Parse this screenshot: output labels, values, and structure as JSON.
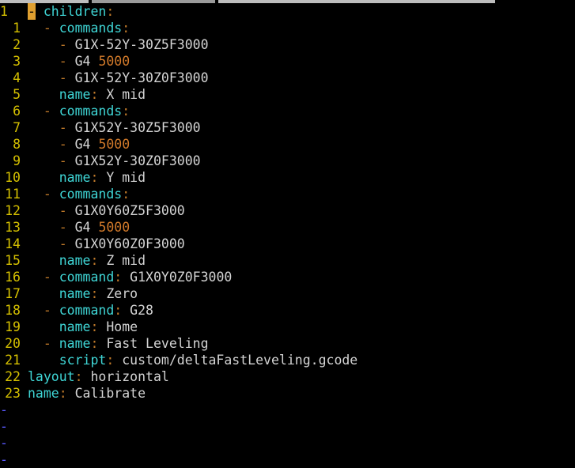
{
  "colors": {
    "background": "#000000",
    "line_number": "#d6c100",
    "key": "#3fd6d6",
    "punctuation": "#c07a2a",
    "number": "#d27a2a",
    "text": "#d4d4d4",
    "cursor": "#e0a030",
    "tilde": "#5a5aff"
  },
  "editor": {
    "lines": [
      {
        "num": "1",
        "tokens": [
          {
            "t": "cursor",
            "v": "-"
          },
          {
            "t": "plain",
            "v": " "
          },
          {
            "t": "key",
            "v": "children"
          },
          {
            "t": "punct",
            "v": ":"
          }
        ]
      },
      {
        "num": "1",
        "tokens": [
          {
            "t": "plain",
            "v": "  "
          },
          {
            "t": "punct",
            "v": "- "
          },
          {
            "t": "key",
            "v": "commands"
          },
          {
            "t": "punct",
            "v": ":"
          }
        ]
      },
      {
        "num": "2",
        "tokens": [
          {
            "t": "plain",
            "v": "    "
          },
          {
            "t": "punct",
            "v": "- "
          },
          {
            "t": "val",
            "v": "G1X-52Y-30Z5F3000"
          }
        ]
      },
      {
        "num": "3",
        "tokens": [
          {
            "t": "plain",
            "v": "    "
          },
          {
            "t": "punct",
            "v": "- "
          },
          {
            "t": "val",
            "v": "G4 "
          },
          {
            "t": "num",
            "v": "5000"
          }
        ]
      },
      {
        "num": "4",
        "tokens": [
          {
            "t": "plain",
            "v": "    "
          },
          {
            "t": "punct",
            "v": "- "
          },
          {
            "t": "val",
            "v": "G1X-52Y-30Z0F3000"
          }
        ]
      },
      {
        "num": "5",
        "tokens": [
          {
            "t": "plain",
            "v": "    "
          },
          {
            "t": "key",
            "v": "name"
          },
          {
            "t": "punct",
            "v": ":"
          },
          {
            "t": "val",
            "v": " X mid"
          }
        ]
      },
      {
        "num": "6",
        "tokens": [
          {
            "t": "plain",
            "v": "  "
          },
          {
            "t": "punct",
            "v": "- "
          },
          {
            "t": "key",
            "v": "commands"
          },
          {
            "t": "punct",
            "v": ":"
          }
        ]
      },
      {
        "num": "7",
        "tokens": [
          {
            "t": "plain",
            "v": "    "
          },
          {
            "t": "punct",
            "v": "- "
          },
          {
            "t": "val",
            "v": "G1X52Y-30Z5F3000"
          }
        ]
      },
      {
        "num": "8",
        "tokens": [
          {
            "t": "plain",
            "v": "    "
          },
          {
            "t": "punct",
            "v": "- "
          },
          {
            "t": "val",
            "v": "G4 "
          },
          {
            "t": "num",
            "v": "5000"
          }
        ]
      },
      {
        "num": "9",
        "tokens": [
          {
            "t": "plain",
            "v": "    "
          },
          {
            "t": "punct",
            "v": "- "
          },
          {
            "t": "val",
            "v": "G1X52Y-30Z0F3000"
          }
        ]
      },
      {
        "num": "10",
        "tokens": [
          {
            "t": "plain",
            "v": "    "
          },
          {
            "t": "key",
            "v": "name"
          },
          {
            "t": "punct",
            "v": ":"
          },
          {
            "t": "val",
            "v": " Y mid"
          }
        ]
      },
      {
        "num": "11",
        "tokens": [
          {
            "t": "plain",
            "v": "  "
          },
          {
            "t": "punct",
            "v": "- "
          },
          {
            "t": "key",
            "v": "commands"
          },
          {
            "t": "punct",
            "v": ":"
          }
        ]
      },
      {
        "num": "12",
        "tokens": [
          {
            "t": "plain",
            "v": "    "
          },
          {
            "t": "punct",
            "v": "- "
          },
          {
            "t": "val",
            "v": "G1X0Y60Z5F3000"
          }
        ]
      },
      {
        "num": "13",
        "tokens": [
          {
            "t": "plain",
            "v": "    "
          },
          {
            "t": "punct",
            "v": "- "
          },
          {
            "t": "val",
            "v": "G4 "
          },
          {
            "t": "num",
            "v": "5000"
          }
        ]
      },
      {
        "num": "14",
        "tokens": [
          {
            "t": "plain",
            "v": "    "
          },
          {
            "t": "punct",
            "v": "- "
          },
          {
            "t": "val",
            "v": "G1X0Y60Z0F3000"
          }
        ]
      },
      {
        "num": "15",
        "tokens": [
          {
            "t": "plain",
            "v": "    "
          },
          {
            "t": "key",
            "v": "name"
          },
          {
            "t": "punct",
            "v": ":"
          },
          {
            "t": "val",
            "v": " Z mid"
          }
        ]
      },
      {
        "num": "16",
        "tokens": [
          {
            "t": "plain",
            "v": "  "
          },
          {
            "t": "punct",
            "v": "- "
          },
          {
            "t": "key",
            "v": "command"
          },
          {
            "t": "punct",
            "v": ":"
          },
          {
            "t": "val",
            "v": " G1X0Y0Z0F3000"
          }
        ]
      },
      {
        "num": "17",
        "tokens": [
          {
            "t": "plain",
            "v": "    "
          },
          {
            "t": "key",
            "v": "name"
          },
          {
            "t": "punct",
            "v": ":"
          },
          {
            "t": "val",
            "v": " Zero"
          }
        ]
      },
      {
        "num": "18",
        "tokens": [
          {
            "t": "plain",
            "v": "  "
          },
          {
            "t": "punct",
            "v": "- "
          },
          {
            "t": "key",
            "v": "command"
          },
          {
            "t": "punct",
            "v": ":"
          },
          {
            "t": "val",
            "v": " G28"
          }
        ]
      },
      {
        "num": "19",
        "tokens": [
          {
            "t": "plain",
            "v": "    "
          },
          {
            "t": "key",
            "v": "name"
          },
          {
            "t": "punct",
            "v": ":"
          },
          {
            "t": "val",
            "v": " Home"
          }
        ]
      },
      {
        "num": "20",
        "tokens": [
          {
            "t": "plain",
            "v": "  "
          },
          {
            "t": "punct",
            "v": "- "
          },
          {
            "t": "key",
            "v": "name"
          },
          {
            "t": "punct",
            "v": ":"
          },
          {
            "t": "val",
            "v": " Fast Leveling"
          }
        ]
      },
      {
        "num": "21",
        "tokens": [
          {
            "t": "plain",
            "v": "    "
          },
          {
            "t": "key",
            "v": "script"
          },
          {
            "t": "punct",
            "v": ":"
          },
          {
            "t": "val",
            "v": " custom/deltaFastLeveling.gcode"
          }
        ]
      },
      {
        "num": "22",
        "tokens": [
          {
            "t": "key",
            "v": "layout"
          },
          {
            "t": "punct",
            "v": ":"
          },
          {
            "t": "val",
            "v": " horizontal"
          }
        ]
      },
      {
        "num": "23",
        "tokens": [
          {
            "t": "key",
            "v": "name"
          },
          {
            "t": "punct",
            "v": ":"
          },
          {
            "t": "val",
            "v": " Calibrate"
          }
        ]
      }
    ],
    "empty_line_markers": [
      "-",
      "-",
      "-",
      "-"
    ]
  }
}
